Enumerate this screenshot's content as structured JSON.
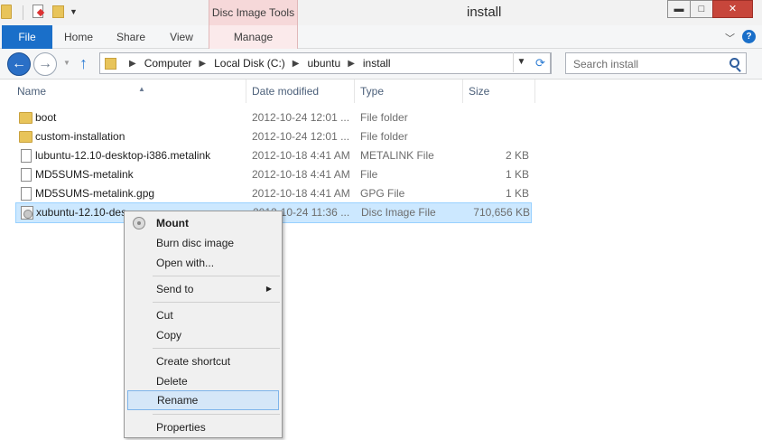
{
  "window": {
    "title": "install",
    "context_tab_group": "Disc Image Tools",
    "controls": {
      "minimize": "▬",
      "maximize": "□",
      "close": "✕"
    }
  },
  "ribbon": {
    "tabs": [
      "File",
      "Home",
      "Share",
      "View",
      "Manage"
    ],
    "expand_icon": "chevron-down-icon",
    "help": "?"
  },
  "navigation": {
    "breadcrumbs": [
      "Computer",
      "Local Disk (C:)",
      "ubuntu",
      "install"
    ],
    "search_placeholder": "Search install"
  },
  "columns": [
    "Name",
    "Date modified",
    "Type",
    "Size"
  ],
  "files": [
    {
      "name": "boot",
      "date": "2012-10-24 12:01 ...",
      "type": "File folder",
      "size": "",
      "icon": "folder-icon"
    },
    {
      "name": "custom-installation",
      "date": "2012-10-24 12:01 ...",
      "type": "File folder",
      "size": "",
      "icon": "folder-icon"
    },
    {
      "name": "lubuntu-12.10-desktop-i386.metalink",
      "date": "2012-10-18 4:41 AM",
      "type": "METALINK File",
      "size": "2 KB",
      "icon": "file-icon"
    },
    {
      "name": "MD5SUMS-metalink",
      "date": "2012-10-18 4:41 AM",
      "type": "File",
      "size": "1 KB",
      "icon": "file-icon"
    },
    {
      "name": "MD5SUMS-metalink.gpg",
      "date": "2012-10-18 4:41 AM",
      "type": "GPG File",
      "size": "1 KB",
      "icon": "file-icon"
    },
    {
      "name": "xubuntu-12.10-des",
      "date": "2012-10-24 11:36 ...",
      "type": "Disc Image File",
      "size": "710,656 KB",
      "icon": "disc-image-icon",
      "selected": true
    }
  ],
  "context_menu": {
    "items": [
      "Mount",
      "Burn disc image",
      "Open with...",
      "Send to",
      "Cut",
      "Copy",
      "Create shortcut",
      "Delete",
      "Rename",
      "Properties"
    ],
    "highlighted": "Rename"
  }
}
